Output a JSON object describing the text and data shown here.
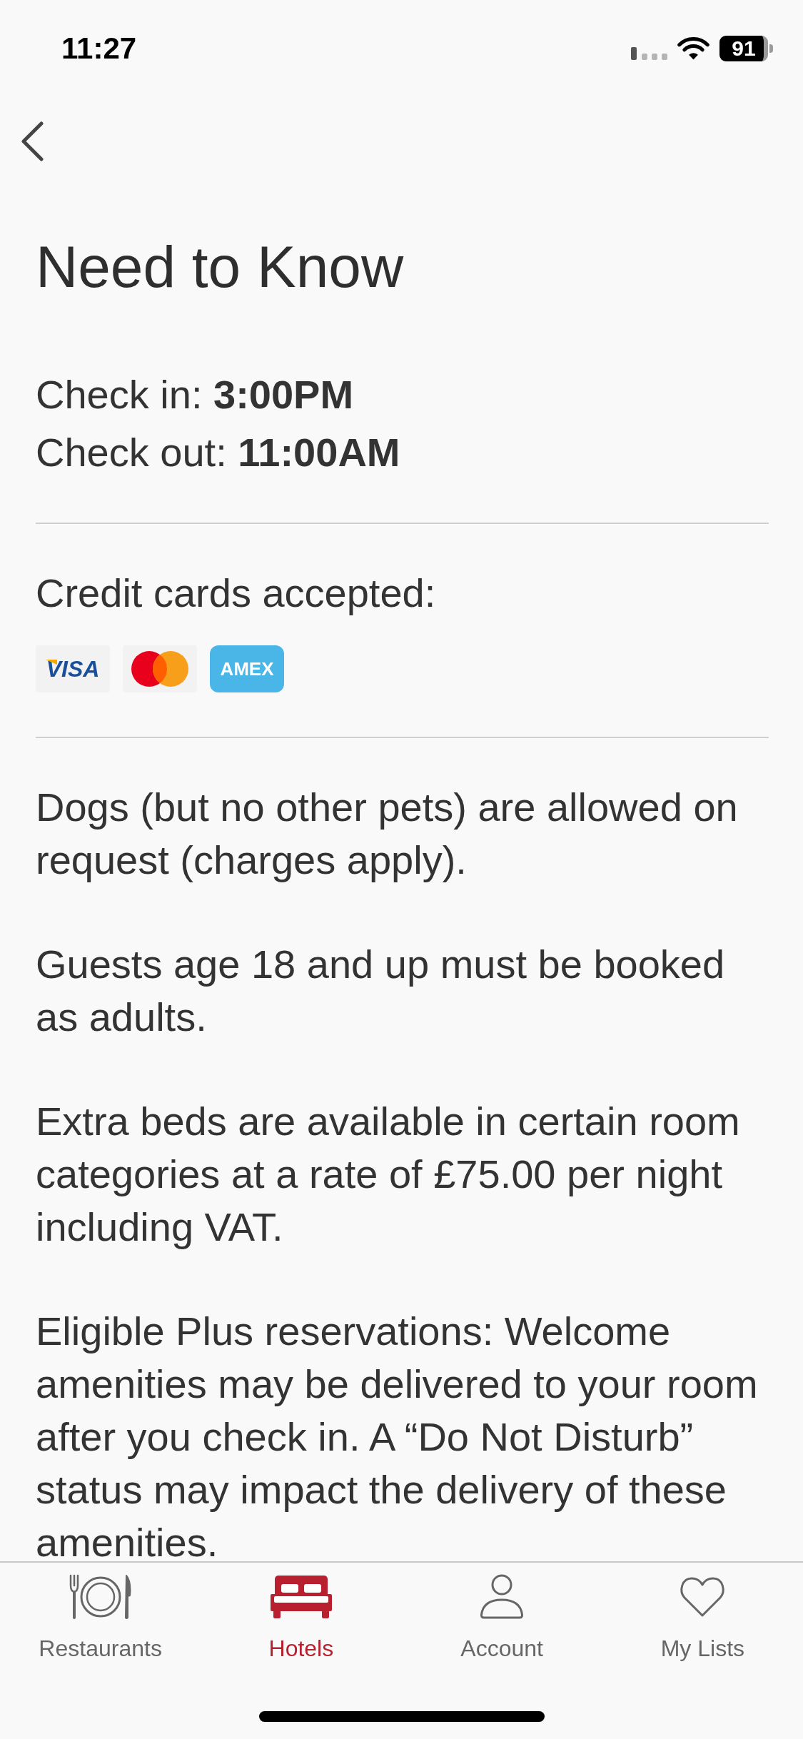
{
  "status_bar": {
    "time": "11:27",
    "battery": "91"
  },
  "title": "Need to Know",
  "check_times": [
    "Check in: **3:00PM**",
    "Check out: **11:00AM**"
  ],
  "payment": {
    "label": "Credit cards accepted:",
    "cards": [
      {
        "kind": "visa",
        "label": "VISA"
      },
      {
        "kind": "mastercard"
      },
      {
        "kind": "amex",
        "label": "AMEX"
      }
    ]
  },
  "policies": [
    "Dogs (but no other pets) are allowed on request (charges apply).",
    "Guests age 18 and up must be booked as adults.",
    "Extra beds are available in certain room categories at a rate of £75.00 per night including VAT.",
    "Eligible Plus reservations: Welcome amenities may be delivered to your room after you check in. A “Do Not Disturb” status may impact the delivery of these amenities."
  ],
  "tab_bar": [
    {
      "label": "Restaurants",
      "kind": "restaurants",
      "selected": false
    },
    {
      "label": "Hotels",
      "kind": "hotels",
      "selected": true
    },
    {
      "label": "Account",
      "kind": "account",
      "selected": false
    },
    {
      "label": "My Lists",
      "kind": "lists",
      "selected": false
    }
  ]
}
